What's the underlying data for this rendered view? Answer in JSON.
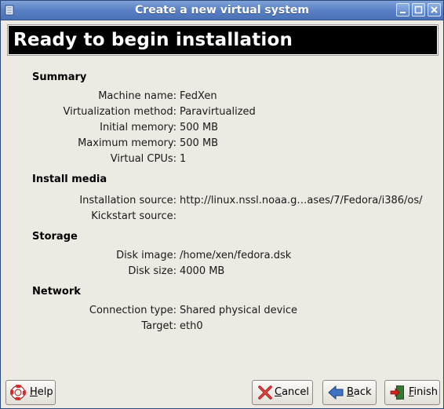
{
  "window": {
    "title": "Create a new virtual system",
    "banner": "Ready to begin installation"
  },
  "sections": [
    {
      "heading": "Summary",
      "rows": [
        {
          "label": "Machine name:",
          "value": "FedXen"
        },
        {
          "label": "Virtualization method:",
          "value": "Paravirtualized"
        },
        {
          "label": "Initial memory:",
          "value": "500 MB"
        },
        {
          "label": "Maximum memory:",
          "value": "500 MB"
        },
        {
          "label": "Virtual CPUs:",
          "value": "1"
        }
      ]
    },
    {
      "heading": "Install media",
      "rows": [
        {
          "label": "Installation source:",
          "value": "http://linux.nssl.noaa.g…ases/7/Fedora/i386/os/"
        },
        {
          "label": "Kickstart source:",
          "value": ""
        }
      ]
    },
    {
      "heading": "Storage",
      "rows": [
        {
          "label": "Disk image:",
          "value": "/home/xen/fedora.dsk"
        },
        {
          "label": "Disk size:",
          "value": "4000 MB"
        }
      ]
    },
    {
      "heading": "Network",
      "rows": [
        {
          "label": "Connection type:",
          "value": "Shared physical device"
        },
        {
          "label": "Target:",
          "value": "eth0"
        }
      ]
    }
  ],
  "buttons": {
    "help": {
      "mnemonic": "H",
      "rest": "elp"
    },
    "cancel": {
      "mnemonic": "C",
      "rest": "ancel"
    },
    "back": {
      "mnemonic": "B",
      "rest": "ack"
    },
    "finish": {
      "mnemonic": "F",
      "rest": "inish"
    }
  },
  "colors": {
    "titlebar": "#5a80c4",
    "banner_bg": "#000000",
    "window_bg": "#ede9e3"
  }
}
